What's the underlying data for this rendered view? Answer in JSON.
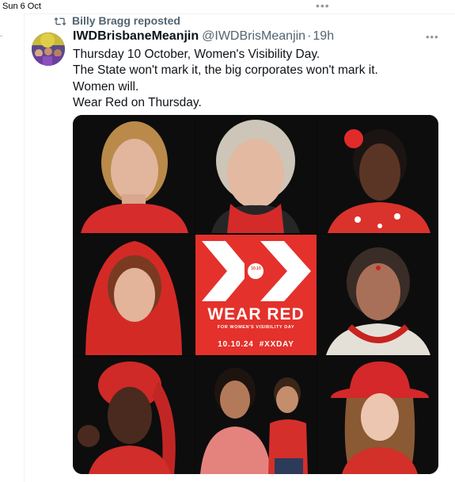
{
  "status": {
    "date": "Sun 6 Oct"
  },
  "repost": {
    "label": "Billy Bragg reposted",
    "icon": "repost-icon"
  },
  "author": {
    "display_name": "IWDBrisbaneMeanjin",
    "handle": "@IWDBrisMeanjin",
    "separator": "·",
    "time": "19h"
  },
  "tweet": {
    "lines": [
      "Thursday 10 October, Women's Visibility Day.",
      "The State won't mark it, the big corporates won't mark it.",
      "Women will.",
      "Wear Red on Thursday."
    ]
  },
  "media": {
    "center_logo_small": "10.10",
    "center_title": "WEAR RED",
    "center_subtitle": "FOR WOMEN'S VISIBILITY DAY",
    "center_footer": "10.10.24  #XXDAY"
  },
  "colors": {
    "accent_red": "#e4312b",
    "secondary_text": "#536471",
    "primary_text": "#0f1419"
  }
}
